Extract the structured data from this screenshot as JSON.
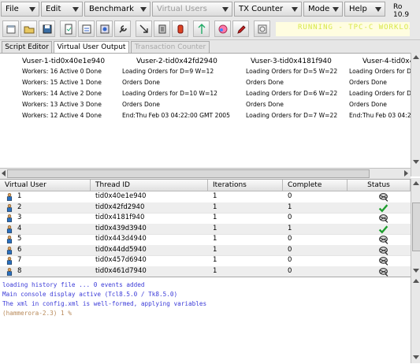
{
  "menu": {
    "items": [
      {
        "label": "File",
        "disabled": false
      },
      {
        "label": "Edit",
        "disabled": false
      },
      {
        "label": "Benchmark",
        "disabled": false
      },
      {
        "label": "Virtual Users",
        "disabled": true
      },
      {
        "label": "TX Counter",
        "disabled": false
      },
      {
        "label": "Mode",
        "disabled": false
      },
      {
        "label": "Help",
        "disabled": false
      }
    ],
    "version": "Ro 10.9"
  },
  "toolbar": {
    "icons": [
      "save-icon",
      "open-icon",
      "floppy-icon",
      "load-script-icon",
      "build-icon",
      "configure-icon",
      "options-icon",
      "transfer-icon",
      "run-icon",
      "stop-icon",
      "pause-icon",
      "graph-icon",
      "pencil-icon",
      "autopilot-icon"
    ],
    "status_text": "RUNNING - TPC-C WORKLOAD"
  },
  "tabs": [
    {
      "label": "Script Editor",
      "state": "normal"
    },
    {
      "label": "Virtual User Output",
      "state": "active"
    },
    {
      "label": "Transaction Counter",
      "state": "disabled"
    }
  ],
  "vuser_output": {
    "columns": [
      {
        "header": "Vuser-1-tid0x40e1e940",
        "lines": [
          "Workers: 16 Active 0 Done",
          "Workers: 15 Active 1 Done",
          "Workers: 14 Active 2 Done",
          "Workers: 13 Active 3 Done",
          "Workers: 12 Active 4 Done"
        ]
      },
      {
        "header": "Vuser-2-tid0x42fd2940",
        "lines": [
          "Loading Orders for D=9 W=12",
          "Orders Done",
          "Loading Orders for D=10 W=12",
          "Orders Done",
          "End:Thu Feb 03 04:22:00 GMT 2005"
        ]
      },
      {
        "header": "Vuser-3-tid0x4181f940",
        "lines": [
          "Loading Orders for D=5 W=22",
          "Orders Done",
          "Loading Orders for D=6 W=22",
          "Orders Done",
          "Loading Orders for D=7 W=22"
        ]
      },
      {
        "header": "Vuser-4-tid0x4",
        "lines": [
          "Loading Orders for D=",
          "Orders Done",
          "Loading Orders for D=",
          "Orders Done",
          "End:Thu Feb 03 04:22"
        ]
      }
    ]
  },
  "table": {
    "headers": [
      "Virtual User",
      "Thread ID",
      "Iterations",
      "Complete",
      "Status"
    ],
    "rows": [
      {
        "user": "1",
        "thread": "tid0x40e1e940",
        "iterations": "1",
        "complete": "0",
        "status": "running-icon"
      },
      {
        "user": "2",
        "thread": "tid0x42fd2940",
        "iterations": "1",
        "complete": "1",
        "status": "complete-check-icon"
      },
      {
        "user": "3",
        "thread": "tid0x4181f940",
        "iterations": "1",
        "complete": "0",
        "status": "running-icon"
      },
      {
        "user": "4",
        "thread": "tid0x439d3940",
        "iterations": "1",
        "complete": "1",
        "status": "complete-check-icon"
      },
      {
        "user": "5",
        "thread": "tid0x443d4940",
        "iterations": "1",
        "complete": "0",
        "status": "running-icon"
      },
      {
        "user": "6",
        "thread": "tid0x44dd5940",
        "iterations": "1",
        "complete": "0",
        "status": "running-icon"
      },
      {
        "user": "7",
        "thread": "tid0x457d6940",
        "iterations": "1",
        "complete": "0",
        "status": "running-icon"
      },
      {
        "user": "8",
        "thread": "tid0x461d7940",
        "iterations": "1",
        "complete": "0",
        "status": "running-icon"
      }
    ]
  },
  "console": {
    "lines": [
      {
        "text": "loading history file ... 0 events added",
        "color": "#3b3bd8"
      },
      {
        "text": "Main console display active (Tcl8.5.0 / Tk8.5.0)",
        "color": "#3b3bd8"
      },
      {
        "text": "The xml in config.xml is well-formed, applying variables",
        "color": "#3b3bd8"
      },
      {
        "text": "(hammerora-2.3) 1 %",
        "color": "#b88a5a"
      }
    ]
  },
  "colors": {
    "check": "#1e9e2e",
    "console_text": "#3b3bd8",
    "prompt": "#b88a5a"
  }
}
